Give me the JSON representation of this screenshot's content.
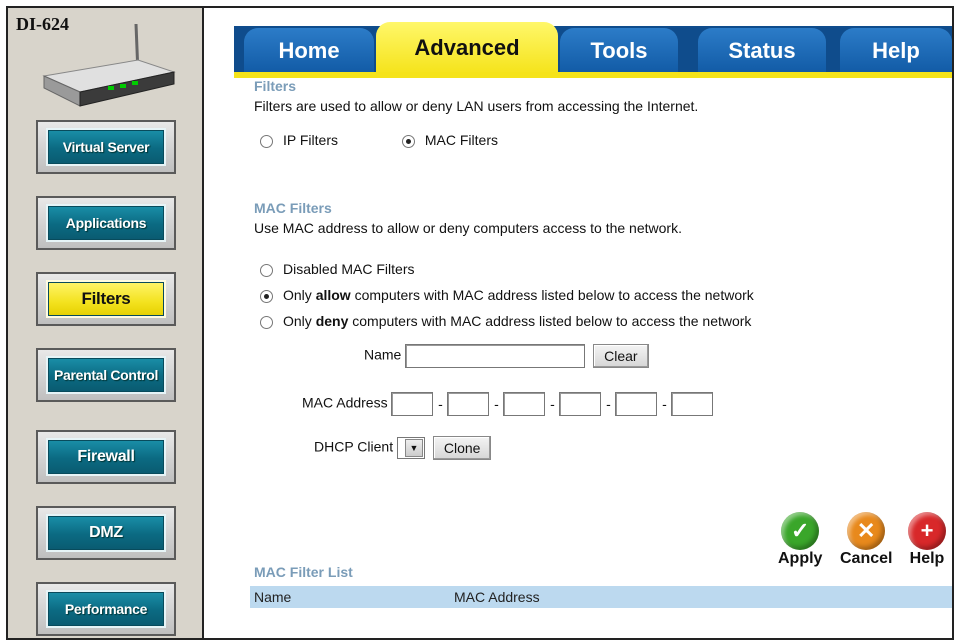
{
  "model": "DI-624",
  "sidebar": {
    "items": [
      {
        "label": "Virtual Server",
        "active": false
      },
      {
        "label": "Applications",
        "active": false
      },
      {
        "label": "Filters",
        "active": true
      },
      {
        "label": "Parental Control",
        "active": false
      },
      {
        "label": "Firewall",
        "active": false
      },
      {
        "label": "DMZ",
        "active": false
      },
      {
        "label": "Performance",
        "active": false
      }
    ]
  },
  "tabs": [
    {
      "label": "Home"
    },
    {
      "label": "Advanced"
    },
    {
      "label": "Tools"
    },
    {
      "label": "Status"
    },
    {
      "label": "Help"
    }
  ],
  "filters": {
    "title": "Filters",
    "description": "Filters are used to allow or deny LAN users from accessing the Internet.",
    "options": [
      "IP Filters",
      "MAC Filters"
    ],
    "selected": "MAC Filters"
  },
  "mac_filters": {
    "title": "MAC Filters",
    "description": "Use MAC address to allow or deny computers access to the network.",
    "opt_disabled": "Disabled MAC Filters",
    "opt_allow_pre": "Only ",
    "opt_allow_bold": "allow",
    "opt_allow_post": " computers with MAC address listed below to access the network",
    "opt_deny_pre": "Only ",
    "opt_deny_bold": "deny",
    "opt_deny_post": " computers with MAC address listed below to access the network",
    "selected": "allow",
    "name_label": "Name",
    "name_value": "",
    "clear_label": "Clear",
    "mac_label": "MAC Address",
    "mac_octets": [
      "",
      "",
      "",
      "",
      "",
      ""
    ],
    "mac_separator": "-",
    "dhcp_label": "DHCP Client",
    "dhcp_value": "",
    "clone_label": "Clone"
  },
  "actions": {
    "apply": "Apply",
    "cancel": "Cancel",
    "help": "Help",
    "colors": {
      "apply": "#3aa62a",
      "cancel": "#e8891c",
      "help": "#d8282a"
    }
  },
  "list": {
    "title": "MAC Filter List",
    "columns": [
      "Name",
      "MAC Address"
    ]
  }
}
